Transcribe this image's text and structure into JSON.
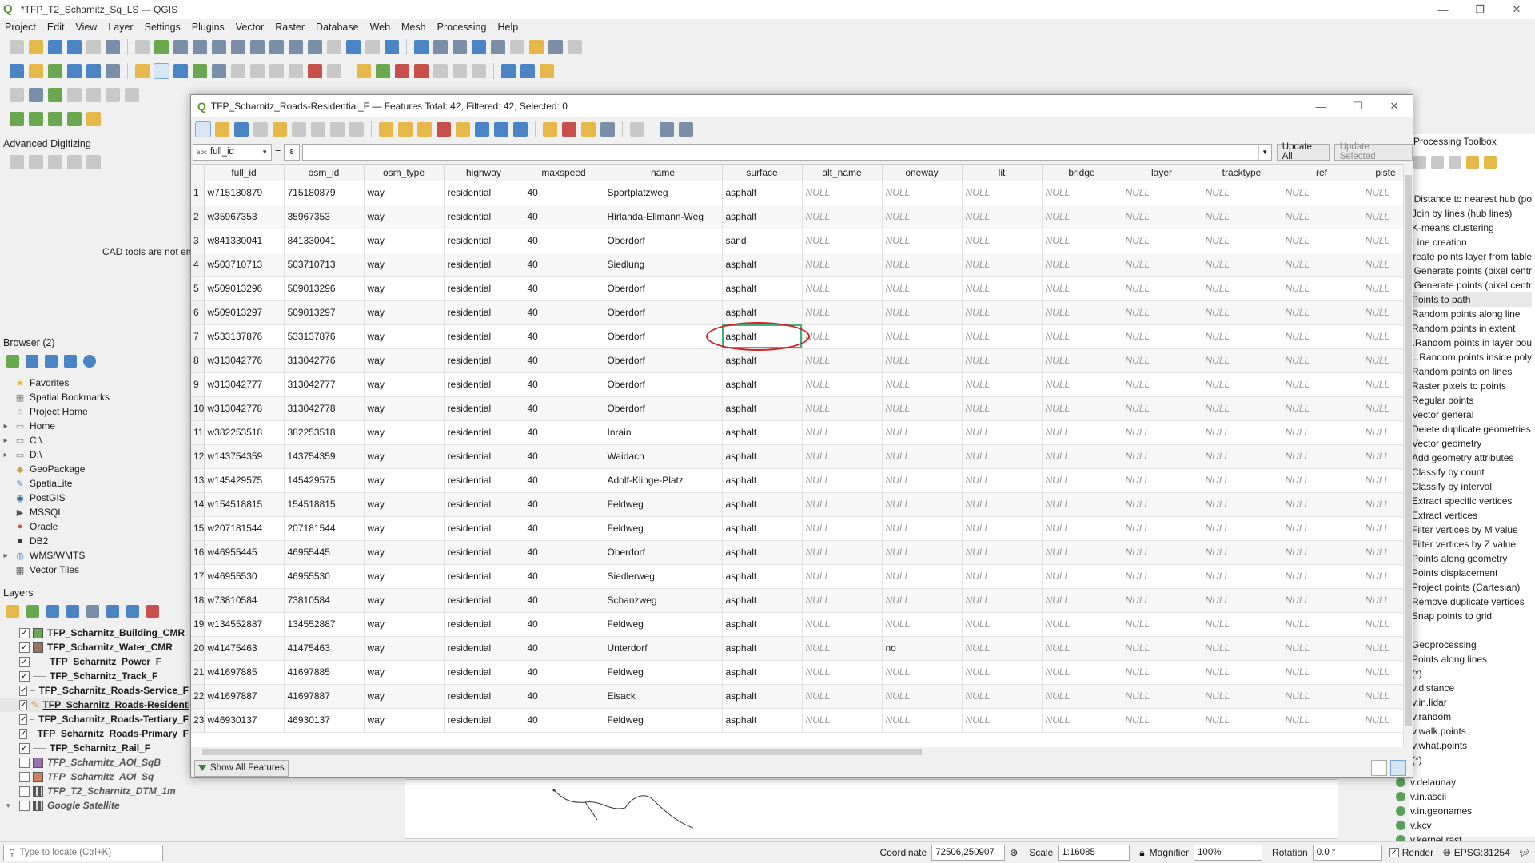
{
  "window": {
    "title": "*TFP_T2_Scharnitz_Sq_LS — QGIS"
  },
  "menu": [
    "Project",
    "Edit",
    "View",
    "Layer",
    "Settings",
    "Plugins",
    "Vector",
    "Raster",
    "Database",
    "Web",
    "Mesh",
    "Processing",
    "Help"
  ],
  "panels": {
    "advanced_digitizing": "Advanced Digitizing",
    "cad_message": "CAD tools are not enabled for the current map tool",
    "browser_title": "Browser (2)",
    "layers_title": "Layers",
    "processing_title": "Processing Toolbox"
  },
  "browser_items": [
    {
      "label": "Favorites",
      "icon": "star-icon",
      "color": "#e8b830"
    },
    {
      "label": "Spatial Bookmarks",
      "icon": "bookmark-icon",
      "color": "#777777"
    },
    {
      "label": "Project Home",
      "icon": "home-icon",
      "color": "#6aa84f"
    },
    {
      "label": "Home",
      "icon": "folder-icon",
      "color": "#888888"
    },
    {
      "label": "C:\\",
      "icon": "drive-icon",
      "color": "#888888"
    },
    {
      "label": "D:\\",
      "icon": "drive-icon",
      "color": "#888888"
    },
    {
      "label": "GeoPackage",
      "icon": "geopackage-icon",
      "color": "#c9a24a"
    },
    {
      "label": "SpatiaLite",
      "icon": "feather-icon",
      "color": "#4a84c4"
    },
    {
      "label": "PostGIS",
      "icon": "elephant-icon",
      "color": "#3a6aa8"
    },
    {
      "label": "MSSQL",
      "icon": "mssql-icon",
      "color": "#555555"
    },
    {
      "label": "Oracle",
      "icon": "oracle-icon",
      "color": "#c9504a"
    },
    {
      "label": "DB2",
      "icon": "db2-icon",
      "color": "#3a3a3a"
    },
    {
      "label": "WMS/WMTS",
      "icon": "globe-icon",
      "color": "#4a84c4"
    },
    {
      "label": "Vector Tiles",
      "icon": "grid-icon",
      "color": "#555555"
    }
  ],
  "layers": [
    {
      "label": "TFP_Scharnitz_Building_CMR",
      "symbol": "#6aa84f",
      "type": "fill",
      "checked": true,
      "style": "bold"
    },
    {
      "label": "TFP_Scharnitz_Water_CMR",
      "symbol": "#a0705a",
      "type": "fill",
      "checked": true,
      "style": "bold"
    },
    {
      "label": "TFP_Scharnitz_Power_F",
      "symbol": "#999999",
      "type": "line",
      "checked": true,
      "style": "bold"
    },
    {
      "label": "TFP_Scharnitz_Track_F",
      "symbol": "#999999",
      "type": "line",
      "checked": true,
      "style": "bold"
    },
    {
      "label": "TFP_Scharnitz_Roads-Service_F",
      "symbol": "#999999",
      "type": "line",
      "checked": true,
      "style": "bold"
    },
    {
      "label": "TFP_Scharnitz_Roads-Residential_F",
      "symbol": "#d9a030",
      "type": "edit",
      "checked": true,
      "style": "bold-underline"
    },
    {
      "label": "TFP_Scharnitz_Roads-Tertiary_F",
      "symbol": "#999999",
      "type": "line",
      "checked": true,
      "style": "bold"
    },
    {
      "label": "TFP_Scharnitz_Roads-Primary_F",
      "symbol": "#999999",
      "type": "line",
      "checked": true,
      "style": "bold"
    },
    {
      "label": "TFP_Scharnitz_Rail_F",
      "symbol": "#999999",
      "type": "line",
      "checked": true,
      "style": "bold"
    },
    {
      "label": "TFP_Scharnitz_AOI_SqB",
      "symbol": "#9a70b0",
      "type": "fill",
      "checked": false,
      "style": "italic"
    },
    {
      "label": "TFP_Scharnitz_AOI_Sq",
      "symbol": "#d08060",
      "type": "fill",
      "checked": false,
      "style": "italic"
    },
    {
      "label": "TFP_T2_Scharnitz_DTM_1m",
      "symbol": "#555555",
      "type": "raster",
      "checked": false,
      "style": "italic"
    },
    {
      "label": "Google Satellite",
      "symbol": "#555555",
      "type": "raster",
      "checked": false,
      "style": "italic"
    }
  ],
  "dialog": {
    "title": "TFP_Scharnitz_Roads-Residential_F — Features Total: 42, Filtered: 42, Selected: 0",
    "field_selector": "full_id",
    "field_type": "abc",
    "equals": "=",
    "epsilon": "ε",
    "update_all": "Update All",
    "update_selected": "Update Selected",
    "show_all": "Show All Features"
  },
  "table": {
    "columns": [
      "full_id",
      "osm_id",
      "osm_type",
      "highway",
      "maxspeed",
      "name",
      "surface",
      "alt_name",
      "oneway",
      "lit",
      "bridge",
      "layer",
      "tracktype",
      "ref",
      "piste"
    ],
    "rows": [
      [
        "w715180879",
        "715180879",
        "way",
        "residential",
        "40",
        "Sportplatzweg",
        "asphalt",
        "NULL",
        "NULL",
        "NULL",
        "NULL",
        "NULL",
        "NULL",
        "NULL",
        "NULL"
      ],
      [
        "w35967353",
        "35967353",
        "way",
        "residential",
        "40",
        "Hirlanda-Ellmann-Weg",
        "asphalt",
        "NULL",
        "NULL",
        "NULL",
        "NULL",
        "NULL",
        "NULL",
        "NULL",
        "NULL"
      ],
      [
        "w841330041",
        "841330041",
        "way",
        "residential",
        "40",
        "Oberdorf",
        "sand",
        "NULL",
        "NULL",
        "NULL",
        "NULL",
        "NULL",
        "NULL",
        "NULL",
        "NULL"
      ],
      [
        "w503710713",
        "503710713",
        "way",
        "residential",
        "40",
        "Siedlung",
        "asphalt",
        "NULL",
        "NULL",
        "NULL",
        "NULL",
        "NULL",
        "NULL",
        "NULL",
        "NULL"
      ],
      [
        "w509013296",
        "509013296",
        "way",
        "residential",
        "40",
        "Oberdorf",
        "asphalt",
        "NULL",
        "NULL",
        "NULL",
        "NULL",
        "NULL",
        "NULL",
        "NULL",
        "NULL"
      ],
      [
        "w509013297",
        "509013297",
        "way",
        "residential",
        "40",
        "Oberdorf",
        "asphalt",
        "NULL",
        "NULL",
        "NULL",
        "NULL",
        "NULL",
        "NULL",
        "NULL",
        "NULL"
      ],
      [
        "w533137876",
        "533137876",
        "way",
        "residential",
        "40",
        "Oberdorf",
        "asphalt",
        "NULL",
        "NULL",
        "NULL",
        "NULL",
        "NULL",
        "NULL",
        "NULL",
        "NULL"
      ],
      [
        "w313042776",
        "313042776",
        "way",
        "residential",
        "40",
        "Oberdorf",
        "asphalt",
        "NULL",
        "NULL",
        "NULL",
        "NULL",
        "NULL",
        "NULL",
        "NULL",
        "NULL"
      ],
      [
        "w313042777",
        "313042777",
        "way",
        "residential",
        "40",
        "Oberdorf",
        "asphalt",
        "NULL",
        "NULL",
        "NULL",
        "NULL",
        "NULL",
        "NULL",
        "NULL",
        "NULL"
      ],
      [
        "w313042778",
        "313042778",
        "way",
        "residential",
        "40",
        "Oberdorf",
        "asphalt",
        "NULL",
        "NULL",
        "NULL",
        "NULL",
        "NULL",
        "NULL",
        "NULL",
        "NULL"
      ],
      [
        "w382253518",
        "382253518",
        "way",
        "residential",
        "40",
        "Inrain",
        "asphalt",
        "NULL",
        "NULL",
        "NULL",
        "NULL",
        "NULL",
        "NULL",
        "NULL",
        "NULL"
      ],
      [
        "w143754359",
        "143754359",
        "way",
        "residential",
        "40",
        "Waidach",
        "asphalt",
        "NULL",
        "NULL",
        "NULL",
        "NULL",
        "NULL",
        "NULL",
        "NULL",
        "NULL"
      ],
      [
        "w145429575",
        "145429575",
        "way",
        "residential",
        "40",
        "Adolf-Klinge-Platz",
        "asphalt",
        "NULL",
        "NULL",
        "NULL",
        "NULL",
        "NULL",
        "NULL",
        "NULL",
        "NULL"
      ],
      [
        "w154518815",
        "154518815",
        "way",
        "residential",
        "40",
        "Feldweg",
        "asphalt",
        "NULL",
        "NULL",
        "NULL",
        "NULL",
        "NULL",
        "NULL",
        "NULL",
        "NULL"
      ],
      [
        "w207181544",
        "207181544",
        "way",
        "residential",
        "40",
        "Feldweg",
        "asphalt",
        "NULL",
        "NULL",
        "NULL",
        "NULL",
        "NULL",
        "NULL",
        "NULL",
        "NULL"
      ],
      [
        "w46955445",
        "46955445",
        "way",
        "residential",
        "40",
        "Oberdorf",
        "asphalt",
        "NULL",
        "NULL",
        "NULL",
        "NULL",
        "NULL",
        "NULL",
        "NULL",
        "NULL"
      ],
      [
        "w46955530",
        "46955530",
        "way",
        "residential",
        "40",
        "Siedlerweg",
        "asphalt",
        "NULL",
        "NULL",
        "NULL",
        "NULL",
        "NULL",
        "NULL",
        "NULL",
        "NULL"
      ],
      [
        "w73810584",
        "73810584",
        "way",
        "residential",
        "40",
        "Schanzweg",
        "asphalt",
        "NULL",
        "NULL",
        "NULL",
        "NULL",
        "NULL",
        "NULL",
        "NULL",
        "NULL"
      ],
      [
        "w134552887",
        "134552887",
        "way",
        "residential",
        "40",
        "Feldweg",
        "asphalt",
        "NULL",
        "NULL",
        "NULL",
        "NULL",
        "NULL",
        "NULL",
        "NULL",
        "NULL"
      ],
      [
        "w41475463",
        "41475463",
        "way",
        "residential",
        "40",
        "Unterdorf",
        "asphalt",
        "NULL",
        "no",
        "NULL",
        "NULL",
        "NULL",
        "NULL",
        "NULL",
        "NULL"
      ],
      [
        "w41697885",
        "41697885",
        "way",
        "residential",
        "40",
        "Feldweg",
        "asphalt",
        "NULL",
        "NULL",
        "NULL",
        "NULL",
        "NULL",
        "NULL",
        "NULL",
        "NULL"
      ],
      [
        "w41697887",
        "41697887",
        "way",
        "residential",
        "40",
        "Eisack",
        "asphalt",
        "NULL",
        "NULL",
        "NULL",
        "NULL",
        "NULL",
        "NULL",
        "NULL",
        "NULL"
      ],
      [
        "w46930137",
        "46930137",
        "way",
        "residential",
        "40",
        "Feldweg",
        "asphalt",
        "NULL",
        "NULL",
        "NULL",
        "NULL",
        "NULL",
        "NULL",
        "NULL",
        "NULL"
      ]
    ],
    "current_cell": {
      "row": 7,
      "column": "surface"
    }
  },
  "processing_items": [
    "Distance to nearest hub (po...",
    "Join by lines (hub lines)",
    "K-means clustering",
    "Line creation",
    "Create points layer from table",
    "Generate points (pixel centr...",
    "Generate points (pixel centr...",
    "Points to path",
    "Random points along line",
    "Random points in extent",
    "Random points in layer bou...",
    "Random points inside poly...",
    "Random points on lines",
    "Raster pixels to points",
    "Regular points",
    "Vector general",
    "Delete duplicate geometries",
    "Vector geometry",
    "Add geometry attributes",
    "Classify by count",
    "Classify by interval",
    "Extract specific vertices",
    "Extract vertices",
    "Filter vertices by M value",
    "Filter vertices by Z value",
    "Points along geometry",
    "Points displacement",
    "Project points (Cartesian)",
    "Remove duplicate vertices",
    "Snap points to grid"
  ],
  "processing_items2": [
    "Geoprocessing",
    "Points along lines",
    "(*)",
    "v.distance",
    "v.in.lidar",
    "v.random",
    "v.walk.points",
    "v.what.points",
    "(*)"
  ],
  "processing_items3": [
    "v.delaunay",
    "v.in.ascii",
    "v.in.geonames",
    "v.kcv",
    "v.kernel.rast"
  ],
  "status": {
    "search_placeholder": "Type to locate (Ctrl+K)",
    "coordinate_label": "Coordinate",
    "coordinate_value": "72506,250907",
    "scale_label": "Scale",
    "scale_value": "1:16085",
    "magnifier_label": "Magnifier",
    "magnifier_value": "100%",
    "rotation_label": "Rotation",
    "rotation_value": "0.0 °",
    "render_label": "Render",
    "crs": "EPSG:31254"
  }
}
